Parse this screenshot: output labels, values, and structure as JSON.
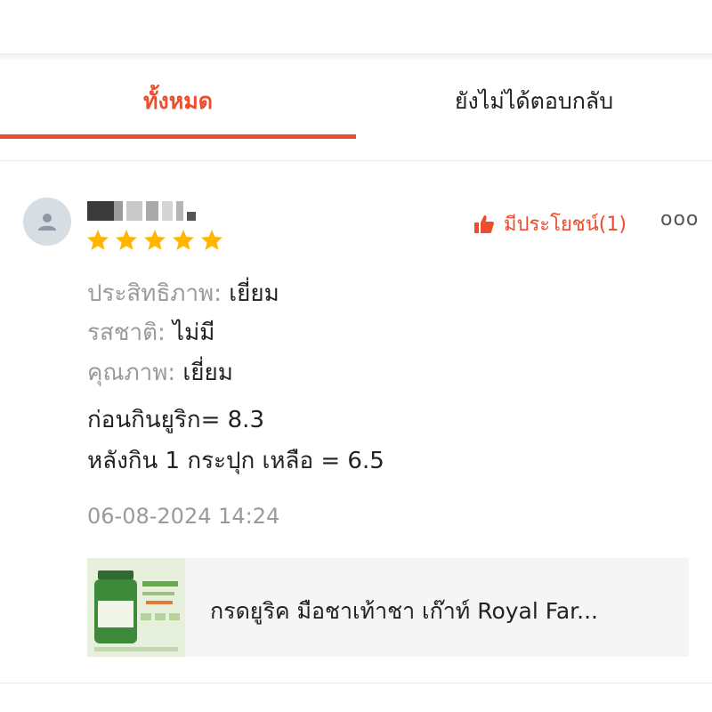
{
  "tabs": {
    "all_label": "ทั้งหมด",
    "unanswered_label": "ยังไม่ได้ตอบกลับ"
  },
  "review": {
    "rating": 5,
    "helpful_label": "มีประโยชน์(1)",
    "more_label": "ooo",
    "attributes": [
      {
        "key": "ประสิทธิภาพ:",
        "value": "เยี่ยม"
      },
      {
        "key": "รสชาติ:",
        "value": "ไม่มี"
      },
      {
        "key": "คุณภาพ:",
        "value": "เยี่ยม"
      }
    ],
    "body_lines": [
      "ก่อนกินยูริก= 8.3",
      "หลังกิน 1 กระปุก เหลือ = 6.5"
    ],
    "date": "06-08-2024 14:24"
  },
  "product": {
    "name": "กรดยูริค มือชาเท้าชา เก๊าท์ Royal Far..."
  },
  "colors": {
    "accent": "#ee4d2d",
    "star": "#ffb400",
    "muted": "#9a9a9a"
  }
}
